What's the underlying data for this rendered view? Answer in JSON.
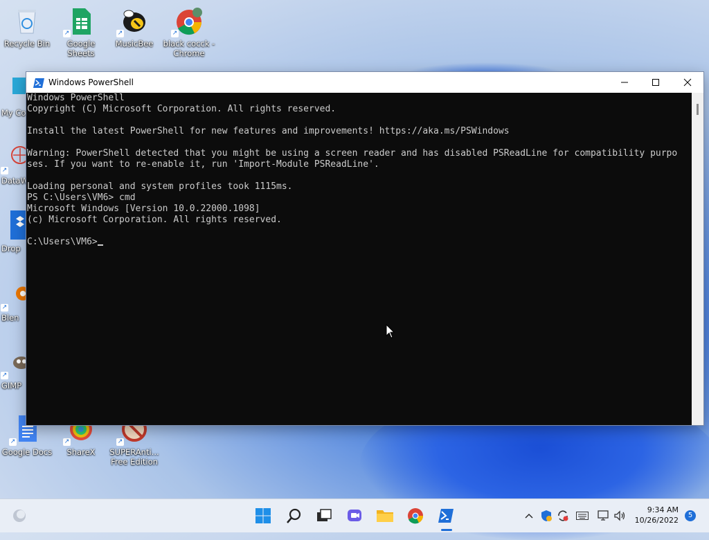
{
  "desktop": {
    "icons": [
      {
        "label": "Recycle Bin"
      },
      {
        "label": "Google Sheets"
      },
      {
        "label": "MusicBee"
      },
      {
        "label": "black cocck - Chrome"
      },
      {
        "label": "My Co"
      },
      {
        "label": "DataW"
      },
      {
        "label": "Drop"
      },
      {
        "label": "Blen"
      },
      {
        "label": "GIMP"
      },
      {
        "label": "Google Docs"
      },
      {
        "label": "ShareX"
      },
      {
        "label": "SUPERAnti... Free Edition"
      }
    ]
  },
  "window": {
    "title": "Windows PowerShell",
    "icon": "powershell-icon",
    "controls": {
      "minimize": "minimize-icon",
      "maximize": "maximize-icon",
      "close": "close-icon"
    },
    "console_lines": [
      "Windows PowerShell",
      "Copyright (C) Microsoft Corporation. All rights reserved.",
      "",
      "Install the latest PowerShell for new features and improvements! https://aka.ms/PSWindows",
      "",
      "Warning: PowerShell detected that you might be using a screen reader and has disabled PSReadLine for compatibility purpo",
      "ses. If you want to re-enable it, run 'Import-Module PSReadLine'.",
      "",
      "Loading personal and system profiles took 1115ms.",
      "PS C:\\Users\\VM6> cmd",
      "Microsoft Windows [Version 10.0.22000.1098]",
      "(c) Microsoft Corporation. All rights reserved.",
      ""
    ],
    "prompt": "C:\\Users\\VM6>"
  },
  "taskbar": {
    "apps": [
      "start-icon",
      "search-icon",
      "task-view-icon",
      "chat-icon",
      "file-explorer-icon",
      "chrome-icon",
      "powershell-icon"
    ],
    "tray": [
      "chevron-up-icon",
      "defender-icon",
      "sync-icon",
      "keyboard-icon",
      "network-icon",
      "volume-icon"
    ],
    "time": "9:34 AM",
    "date": "10/26/2022",
    "notification_count": "5"
  },
  "colors": {
    "console_bg": "#0c0c0c",
    "console_fg": "#cccccc",
    "accent": "#1f6fd8"
  }
}
